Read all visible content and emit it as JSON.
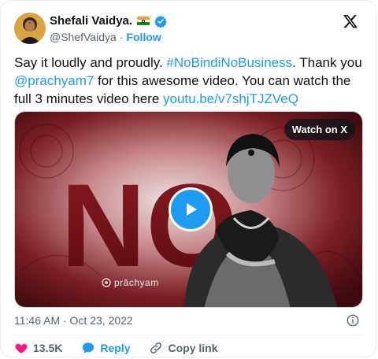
{
  "author": {
    "name": "Shefali Vaidya.",
    "handle": "@ShefVaidya",
    "separator": "·",
    "follow_label": "Follow"
  },
  "tweet": {
    "text_1": "Say it loudly and proudly. ",
    "hashtag": "#NoBindiNoBusiness",
    "text_2": ". Thank you ",
    "mention": "@prachyam7",
    "text_3": " for this awesome video. You can watch the full 3 minutes video here ",
    "link": "youtu.be/v7shjTJZVeQ"
  },
  "media": {
    "watch_label": "Watch on X",
    "brand_text": "prāchyam",
    "big_text": "NO"
  },
  "meta": {
    "timestamp": "11:46 AM · Oct 23, 2022"
  },
  "actions": {
    "like_count": "13.5K",
    "reply_label": "Reply",
    "copy_link_label": "Copy link"
  },
  "colors": {
    "accent": "#1d9bf0",
    "like": "#f91880",
    "text_primary": "#0f1419",
    "text_secondary": "#536471"
  },
  "icons": [
    "avatar",
    "india-flag-icon",
    "verified-badge-icon",
    "x-logo-icon",
    "play-icon",
    "info-icon",
    "heart-icon",
    "reply-icon",
    "link-icon"
  ]
}
